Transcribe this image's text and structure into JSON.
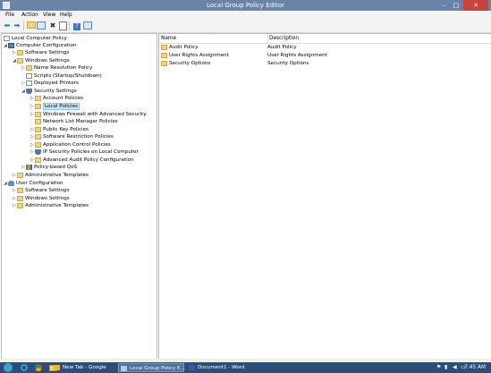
{
  "window": {
    "title": "Local Group Policy Editor",
    "controls": {
      "minimize": "–",
      "maximize": "□",
      "close": "✕"
    }
  },
  "menu": {
    "items": [
      "File",
      "Action",
      "View",
      "Help"
    ]
  },
  "toolbar": {
    "icons": [
      "back-arrow-icon",
      "forward-arrow-icon",
      "up-folder-icon",
      "show-hide-tree-icon",
      "delete-icon",
      "properties-icon",
      "help-icon",
      "console-icon"
    ]
  },
  "tree": {
    "items": [
      {
        "label": "Local Computer Policy",
        "arrow": "",
        "icon": "doc"
      },
      {
        "label": "Computer Configuration",
        "arrow": "◢",
        "icon": "comp"
      },
      {
        "label": "Software Settings",
        "arrow": "▷",
        "icon": "folder"
      },
      {
        "label": "Windows Settings",
        "arrow": "◢",
        "icon": "folder"
      },
      {
        "label": "Name Resolution Policy",
        "arrow": "▷",
        "icon": "folder"
      },
      {
        "label": "Scripts (Startup/Shutdown)",
        "arrow": "",
        "icon": "doc"
      },
      {
        "label": "Deployed Printers",
        "arrow": "▷",
        "icon": "doc"
      },
      {
        "label": "Security Settings",
        "arrow": "◢",
        "icon": "shield"
      },
      {
        "label": "Account Policies",
        "arrow": "▷",
        "icon": "folder"
      },
      {
        "label": "Local Policies",
        "arrow": "▷",
        "icon": "folder"
      },
      {
        "label": "Windows Firewall with Advanced Security",
        "arrow": "▷",
        "icon": "folder"
      },
      {
        "label": "Network List Manager Policies",
        "arrow": "",
        "icon": "folder"
      },
      {
        "label": "Public Key Policies",
        "arrow": "▷",
        "icon": "folder"
      },
      {
        "label": "Software Restriction Policies",
        "arrow": "▷",
        "icon": "folder"
      },
      {
        "label": "Application Control Policies",
        "arrow": "▷",
        "icon": "folder"
      },
      {
        "label": "IP Security Policies on Local Computer",
        "arrow": "▷",
        "icon": "shield"
      },
      {
        "label": "Advanced Audit Policy Configuration",
        "arrow": "▷",
        "icon": "folder"
      },
      {
        "label": "Policy-based QoS",
        "arrow": "▷",
        "icon": "bars"
      },
      {
        "label": "Administrative Templates",
        "arrow": "▷",
        "icon": "folder"
      },
      {
        "label": "User Configuration",
        "arrow": "◢",
        "icon": "user"
      },
      {
        "label": "Software Settings",
        "arrow": "▷",
        "icon": "folder"
      },
      {
        "label": "Windows Settings",
        "arrow": "▷",
        "icon": "folder"
      },
      {
        "label": "Administrative Templates",
        "arrow": "▷",
        "icon": "folder"
      }
    ]
  },
  "list": {
    "columns": [
      "Name",
      "Description"
    ],
    "sort_indicator": "^",
    "rows": [
      {
        "name": "Audit Policy",
        "description": "Audit Policy"
      },
      {
        "name": "User Rights Assignment",
        "description": "User Rights Assignment"
      },
      {
        "name": "Security Options",
        "description": "Security Options"
      }
    ]
  },
  "taskbar": {
    "pinned": [
      "internet-explorer-icon",
      "chrome-icon",
      "file-explorer-icon"
    ],
    "tasks": [
      {
        "label": "New Tab - Google",
        "active": false,
        "icon_color": "#e9ba2f"
      },
      {
        "label": "Local Group Policy E...",
        "active": true,
        "icon_color": "#b9c7da"
      },
      {
        "label": "Document1 - Word",
        "active": false,
        "icon_color": "#2e5fa8"
      }
    ],
    "tray_icons": [
      "flag-icon",
      "network-icon",
      "volume-icon",
      "keyboard-icon"
    ],
    "clock": "7:45 AM"
  }
}
